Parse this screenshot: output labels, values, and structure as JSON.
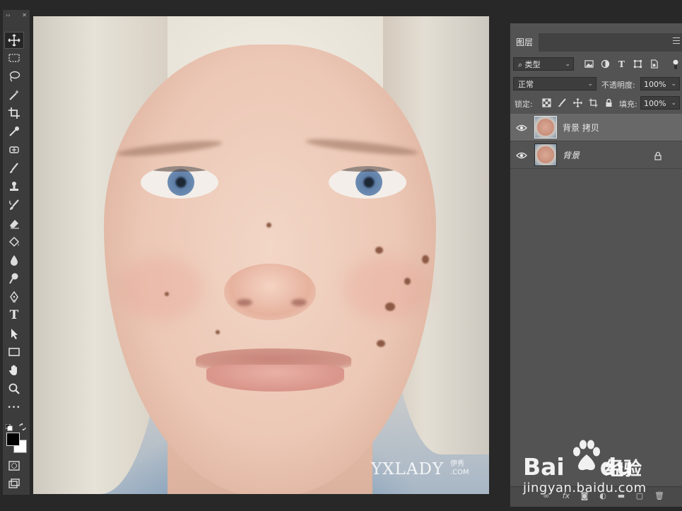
{
  "toolbar": {
    "tools": [
      {
        "name": "move-tool",
        "icon": "move-icon"
      },
      {
        "name": "marquee-tool",
        "icon": "rect-marquee-icon"
      },
      {
        "name": "lasso-tool",
        "icon": "lasso-icon"
      },
      {
        "name": "magic-wand-tool",
        "icon": "magic-wand-icon"
      },
      {
        "name": "crop-tool",
        "icon": "crop-icon"
      },
      {
        "name": "eyedropper-tool",
        "icon": "eyedropper-icon"
      },
      {
        "name": "healing-brush-tool",
        "icon": "healing-brush-icon"
      },
      {
        "name": "brush-tool",
        "icon": "brush-icon"
      },
      {
        "name": "clone-stamp-tool",
        "icon": "stamp-icon"
      },
      {
        "name": "history-brush-tool",
        "icon": "history-brush-icon"
      },
      {
        "name": "eraser-tool",
        "icon": "eraser-icon"
      },
      {
        "name": "paint-bucket-tool",
        "icon": "paint-bucket-icon"
      },
      {
        "name": "blur-tool",
        "icon": "blur-drop-icon"
      },
      {
        "name": "dodge-tool",
        "icon": "dodge-icon"
      },
      {
        "name": "pen-tool",
        "icon": "pen-icon"
      },
      {
        "name": "type-tool",
        "icon": "type-icon"
      },
      {
        "name": "path-selection-tool",
        "icon": "arrow-icon"
      },
      {
        "name": "rectangle-tool",
        "icon": "rectangle-icon"
      },
      {
        "name": "hand-tool",
        "icon": "hand-icon"
      },
      {
        "name": "zoom-tool",
        "icon": "zoom-icon"
      },
      {
        "name": "more-tools",
        "icon": "more-icon"
      }
    ],
    "type_tool_glyph": "T",
    "more_glyph": "•••",
    "colors": {
      "foreground": "#000000",
      "background": "#ffffff"
    }
  },
  "canvas": {
    "watermark": "YXLADY",
    "watermark_cn": "伊秀",
    "watermark_com": ".COM"
  },
  "layers_panel": {
    "tab_label": "图层",
    "filter_label": "类型",
    "filter_search_glyph": "⌕",
    "blend_mode": "正常",
    "opacity_label": "不透明度:",
    "opacity_value": "100%",
    "lock_label": "锁定:",
    "fill_label": "填充:",
    "fill_value": "100%",
    "type_filter_glyph": "T",
    "layers": [
      {
        "name": "背景 拷贝",
        "visible": true,
        "selected": true,
        "locked": false
      },
      {
        "name": "背景",
        "visible": true,
        "selected": false,
        "locked": true
      }
    ],
    "footer": {
      "fx_label": "fx"
    }
  },
  "watermark": {
    "brand": "Bai",
    "brand_du": "du",
    "brand_cn": "经验",
    "url": "jingyan.baidu.com"
  }
}
